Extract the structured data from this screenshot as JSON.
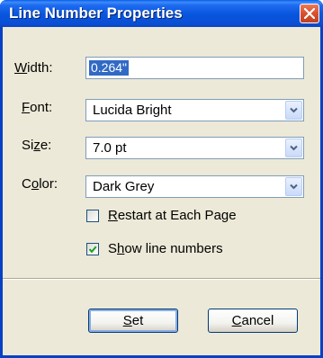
{
  "window": {
    "title": "Line Number Properties"
  },
  "fields": {
    "width": {
      "label_access": "W",
      "label_rest": "idth:",
      "value": "0.264\""
    },
    "font": {
      "label_access": "F",
      "label_rest": "ont:",
      "value": "Lucida Bright"
    },
    "size": {
      "label_pre": "Si",
      "label_access": "z",
      "label_rest": "e:",
      "value": "7.0 pt"
    },
    "color": {
      "label_pre": "C",
      "label_access": "o",
      "label_rest": "lor:",
      "value": "Dark Grey"
    }
  },
  "checkboxes": {
    "restart": {
      "label_access": "R",
      "label_rest": "estart at Each Page",
      "checked": false
    },
    "show": {
      "label_pre": "S",
      "label_access": "h",
      "label_rest": "ow line numbers",
      "checked": true
    }
  },
  "buttons": {
    "set": {
      "label_access": "S",
      "label_rest": "et"
    },
    "cancel": {
      "label_access": "C",
      "label_rest": "ancel"
    }
  },
  "colors": {
    "titlebar": "#0A4FD6",
    "face": "#ECE9D8",
    "selection": "#316AC5",
    "close": "#D9502F"
  },
  "icons": {
    "close": "close-icon",
    "dropdown": "chevron-down-icon",
    "check": "checkmark-icon"
  }
}
